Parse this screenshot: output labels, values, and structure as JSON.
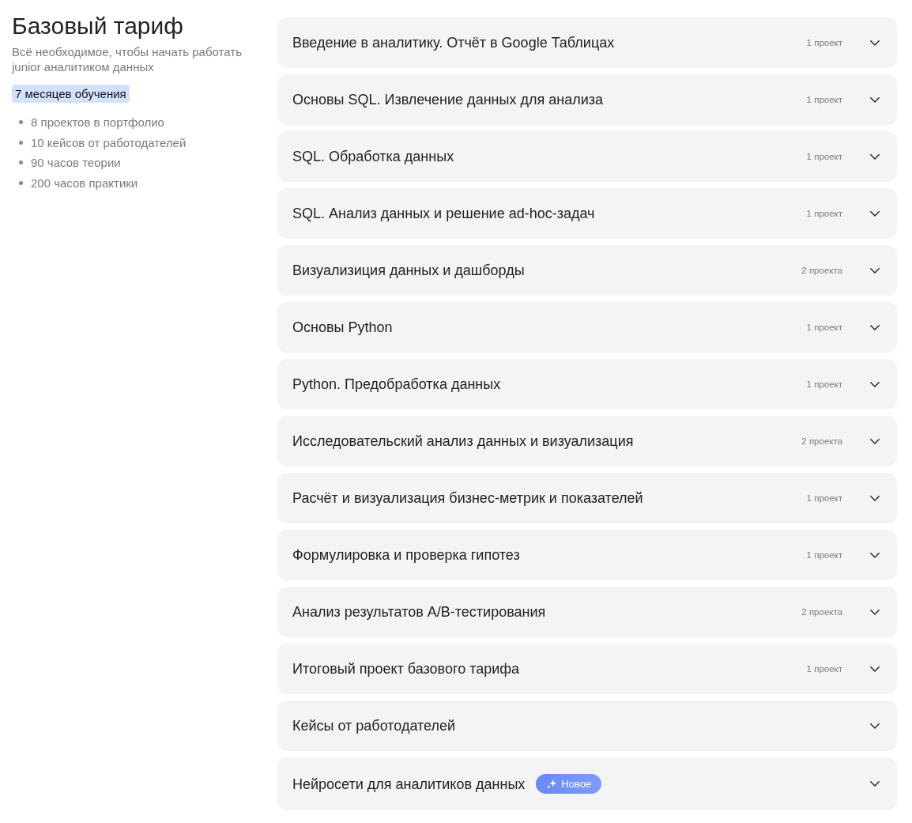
{
  "tariff": {
    "title": "Базовый тариф",
    "subtitle": "Всё необходимое, чтобы начать работать junior аналитиком данных",
    "duration": "7 месяцев обучения",
    "features": [
      "8 проектов в портфолио",
      "10 кейсов от работодателей",
      "90 часов теории",
      "200 часов практики"
    ]
  },
  "modules": [
    {
      "title": "Введение в аналитику. Отчёт в Google Таблицах",
      "projects": "1 проект",
      "expanded": false
    },
    {
      "title": "Основы SQL. Извлечение данных для анализа",
      "projects": "1 проект",
      "expanded": false
    },
    {
      "title": "SQL. Обработка данных",
      "projects": "1 проект",
      "expanded": false
    },
    {
      "title": "SQL. Анализ данных и решение ad-hoc-задач",
      "projects": "1 проект",
      "expanded": false
    },
    {
      "title": "Визуализиция данных и дашборды",
      "projects": "2 проекта",
      "expanded": false
    },
    {
      "title": "Основы Python",
      "projects": "1 проект",
      "expanded": false
    },
    {
      "title": "Python. Предобработка данных",
      "projects": "1 проект",
      "expanded": false
    },
    {
      "title": "Исследовательский анализ данных и визуализация",
      "projects": "2 проекта",
      "expanded": false
    },
    {
      "title": "Расчёт и визуализация бизнес-метрик и показателей",
      "projects": "1 проект",
      "expanded": false
    },
    {
      "title": "Формулировка и проверка гипотез",
      "projects": "1 проект",
      "expanded": false
    },
    {
      "title": "Анализ результатов A/B-тестирования",
      "projects": "2 проекта",
      "expanded": false
    },
    {
      "title": "Итоговый проект базового тарифа",
      "projects": "1 проект",
      "expanded": false
    },
    {
      "title": "Кейсы от работодателей",
      "expanded": false
    },
    {
      "title": "Нейросети для аналитиков данных",
      "badge": "Новое",
      "expanded": false
    }
  ]
}
